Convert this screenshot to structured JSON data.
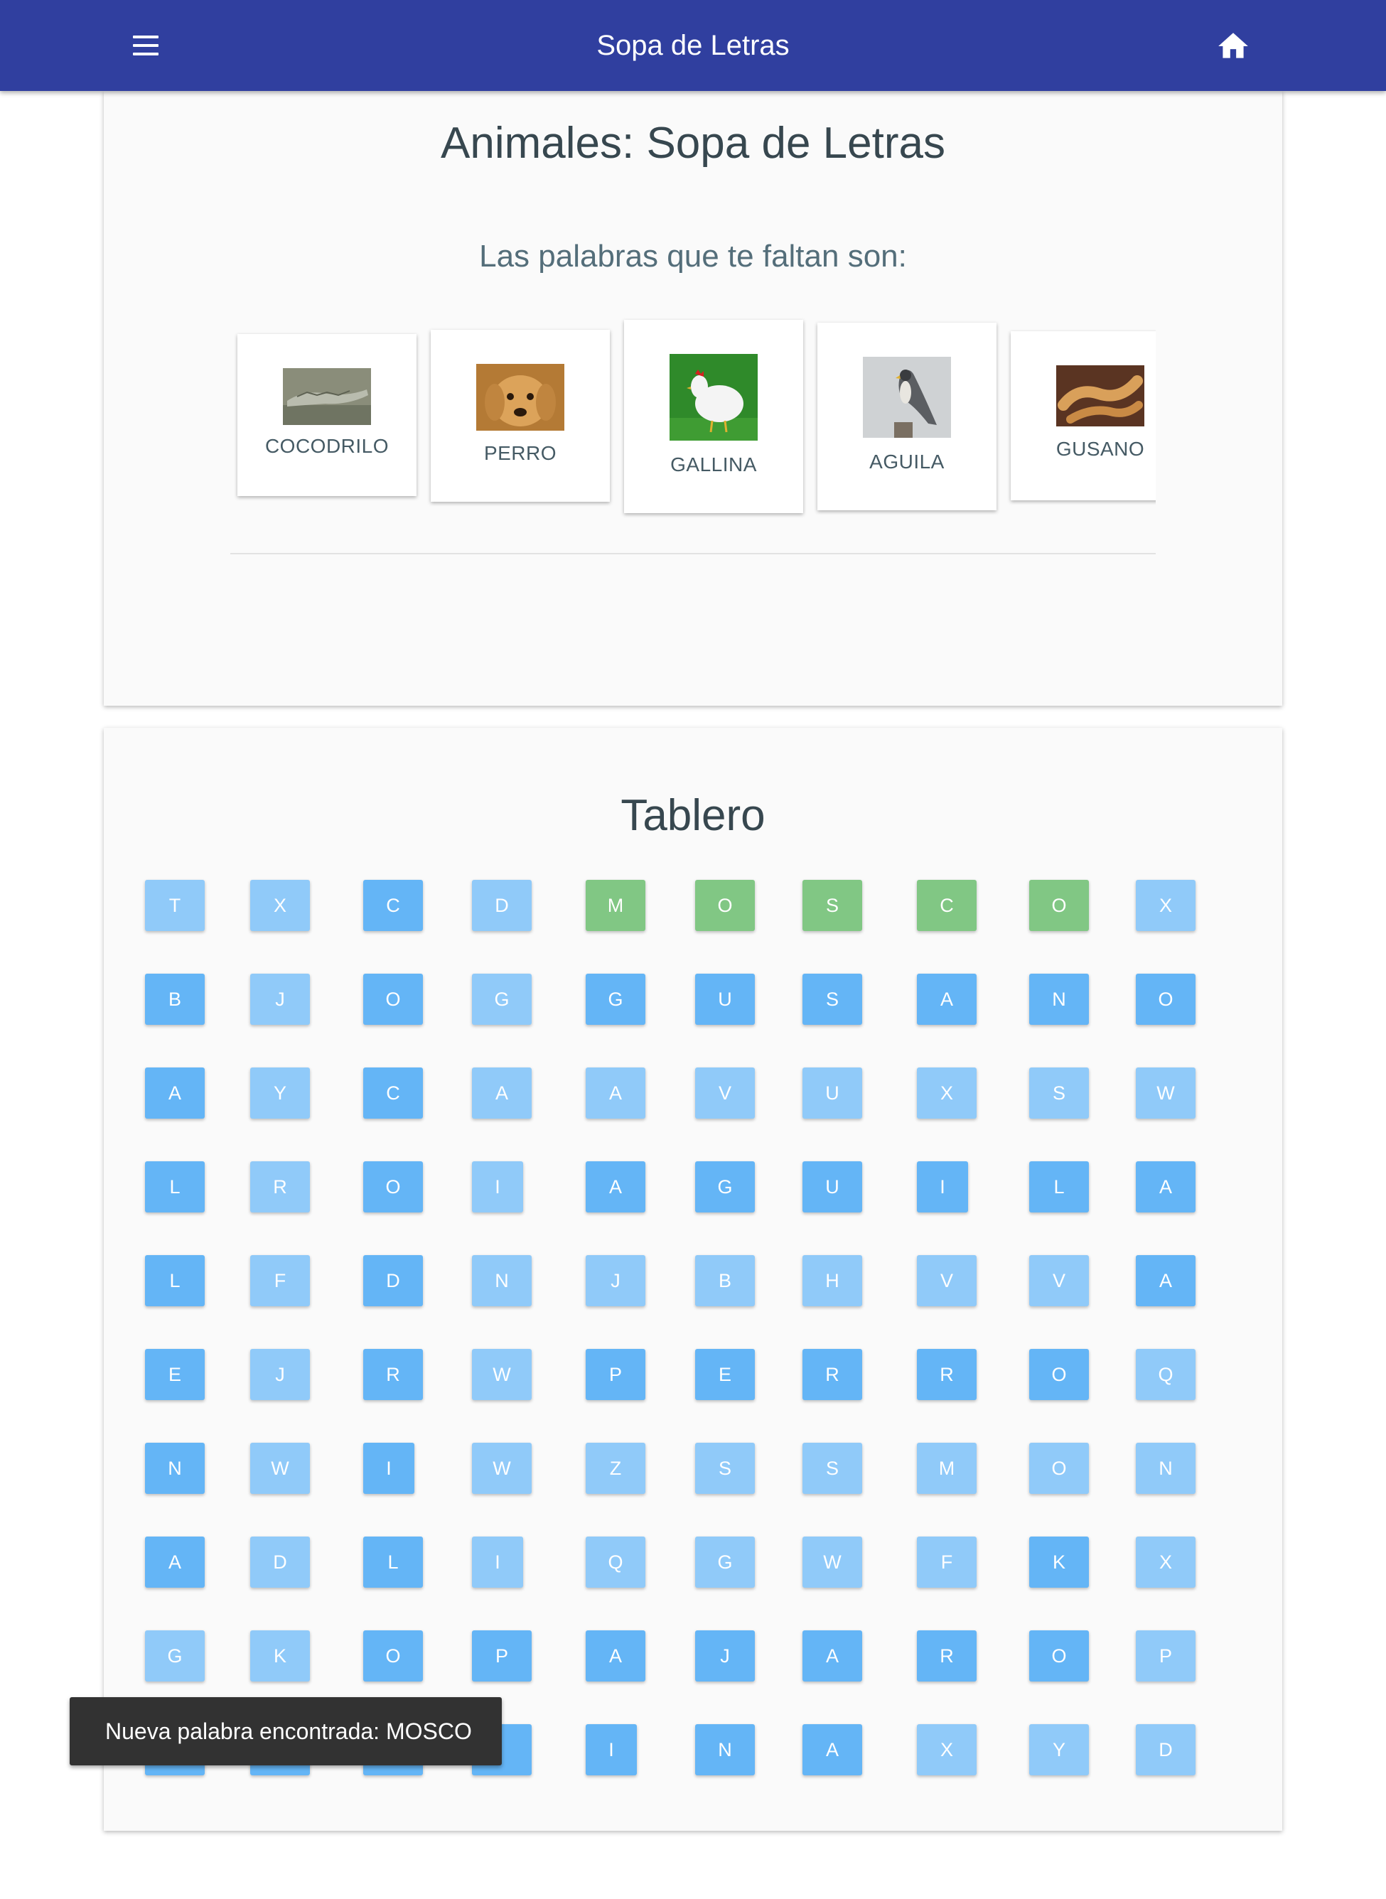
{
  "appbar": {
    "title": "Sopa de Letras",
    "menu_icon": "hamburger-menu-icon",
    "home_icon": "home-icon",
    "bg_color": "#303f9f"
  },
  "header": {
    "title": "Animales: Sopa de Letras",
    "subtitle": "Las palabras que te faltan son:"
  },
  "words": [
    {
      "label": "COCODRILO",
      "image": "crocodile-photo"
    },
    {
      "label": "PERRO",
      "image": "dog-photo"
    },
    {
      "label": "GALLINA",
      "image": "hen-photo"
    },
    {
      "label": "AGUILA",
      "image": "eagle-photo"
    },
    {
      "label": "GUSANO",
      "image": "worm-photo"
    }
  ],
  "board": {
    "title": "Tablero",
    "rows": [
      "TXCDMOSCOX",
      "BJOGGUSANO",
      "AYCAAVUXSW",
      "LROIAGUILA",
      "LFDNJBHVVA",
      "EJRWPERROQ",
      "NWIWZSSMON",
      "ADLIQGWFKX",
      "GKOPAJAROP",
      "????INAXYD"
    ],
    "shades": [
      "LLDLGGGGGL",
      "DLDLDDDDDD",
      "DLDLLLLLLL",
      "DLDLDDDDDD",
      "DLDLLLLLLD",
      "DLDLDDDDDL",
      "DLDLLLLLLL",
      "DLDLLLLLDL",
      "LLDDDDDDDL",
      "DDDDDDDLLL"
    ],
    "colors": {
      "dark": "#64b5f6",
      "light": "#90caf9",
      "found": "#81c784"
    }
  },
  "snackbar": {
    "message": "Nueva palabra encontrada: MOSCO"
  }
}
